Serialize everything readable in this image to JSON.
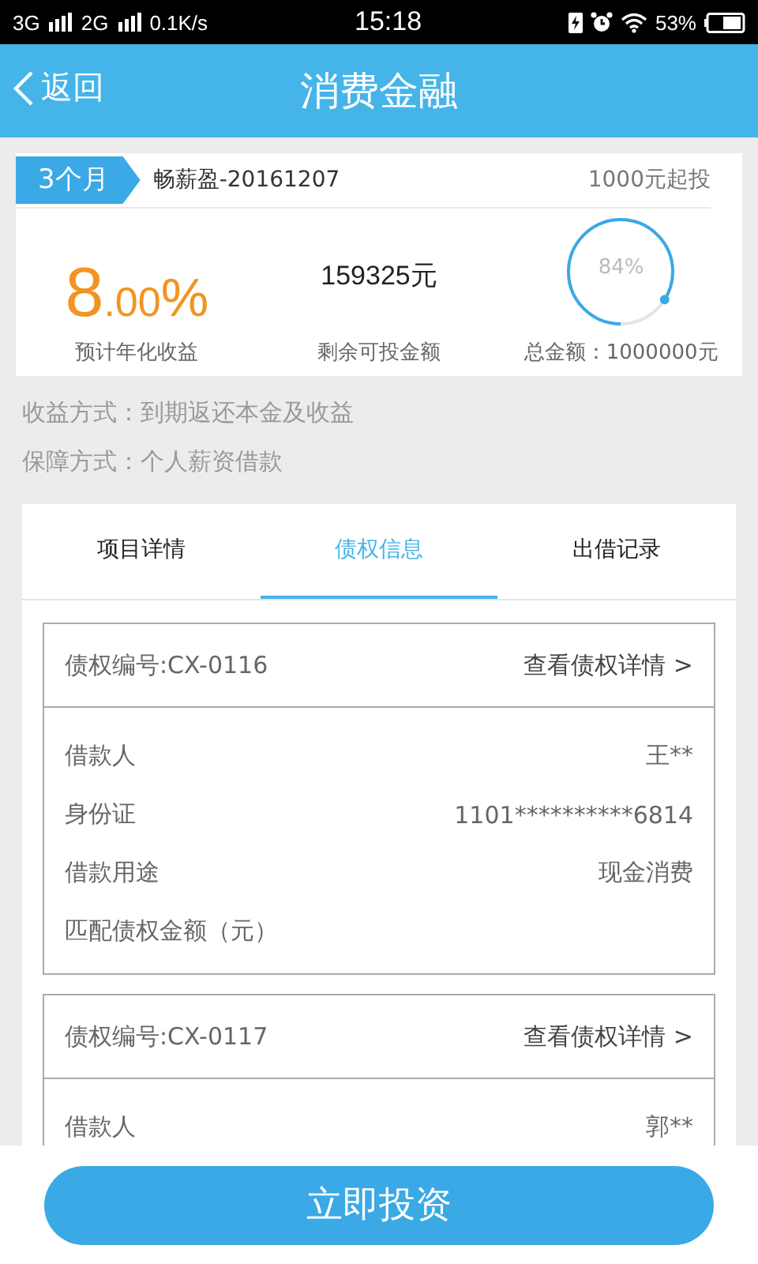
{
  "status_bar": {
    "network_1": "3G",
    "network_2": "2G",
    "speed": "0.1K/s",
    "time": "15:18",
    "battery": "53%"
  },
  "header": {
    "back": "返回",
    "title": "消费金融"
  },
  "product": {
    "term": "3个月",
    "name": "畅薪盈-20161207",
    "min_invest": "1000元起投",
    "rate": {
      "integer": "8",
      "fraction": ".00",
      "unit": "%"
    },
    "rate_label": "预计年化收益",
    "remaining": "159325元",
    "remaining_label": "剩余可投金额",
    "progress": {
      "level": 0.84,
      "text": "84%"
    },
    "total": "总金额：1000000元"
  },
  "info": [
    "收益方式：到期返还本金及收益",
    "保障方式：个人薪资借款"
  ],
  "tabs": [
    {
      "label": "项目详情",
      "selected": false
    },
    {
      "label": "债权信息",
      "selected": true
    },
    {
      "label": "出借记录",
      "selected": false
    }
  ],
  "debts": [
    {
      "code": "债权编号:CX-0116",
      "link": "查看债权详情 >",
      "rows": [
        {
          "label": "借款人",
          "value": "王**"
        },
        {
          "label": "身份证",
          "value": "1101**********6814"
        },
        {
          "label": "借款用途",
          "value": "现金消费"
        },
        {
          "label": "匹配债权金额（元）"
        }
      ]
    },
    {
      "code": "债权编号:CX-0117",
      "link": "查看债权详情 >",
      "rows": [
        {
          "label": "借款人",
          "value": "郭**"
        }
      ]
    }
  ],
  "invest_button": "立即投资"
}
